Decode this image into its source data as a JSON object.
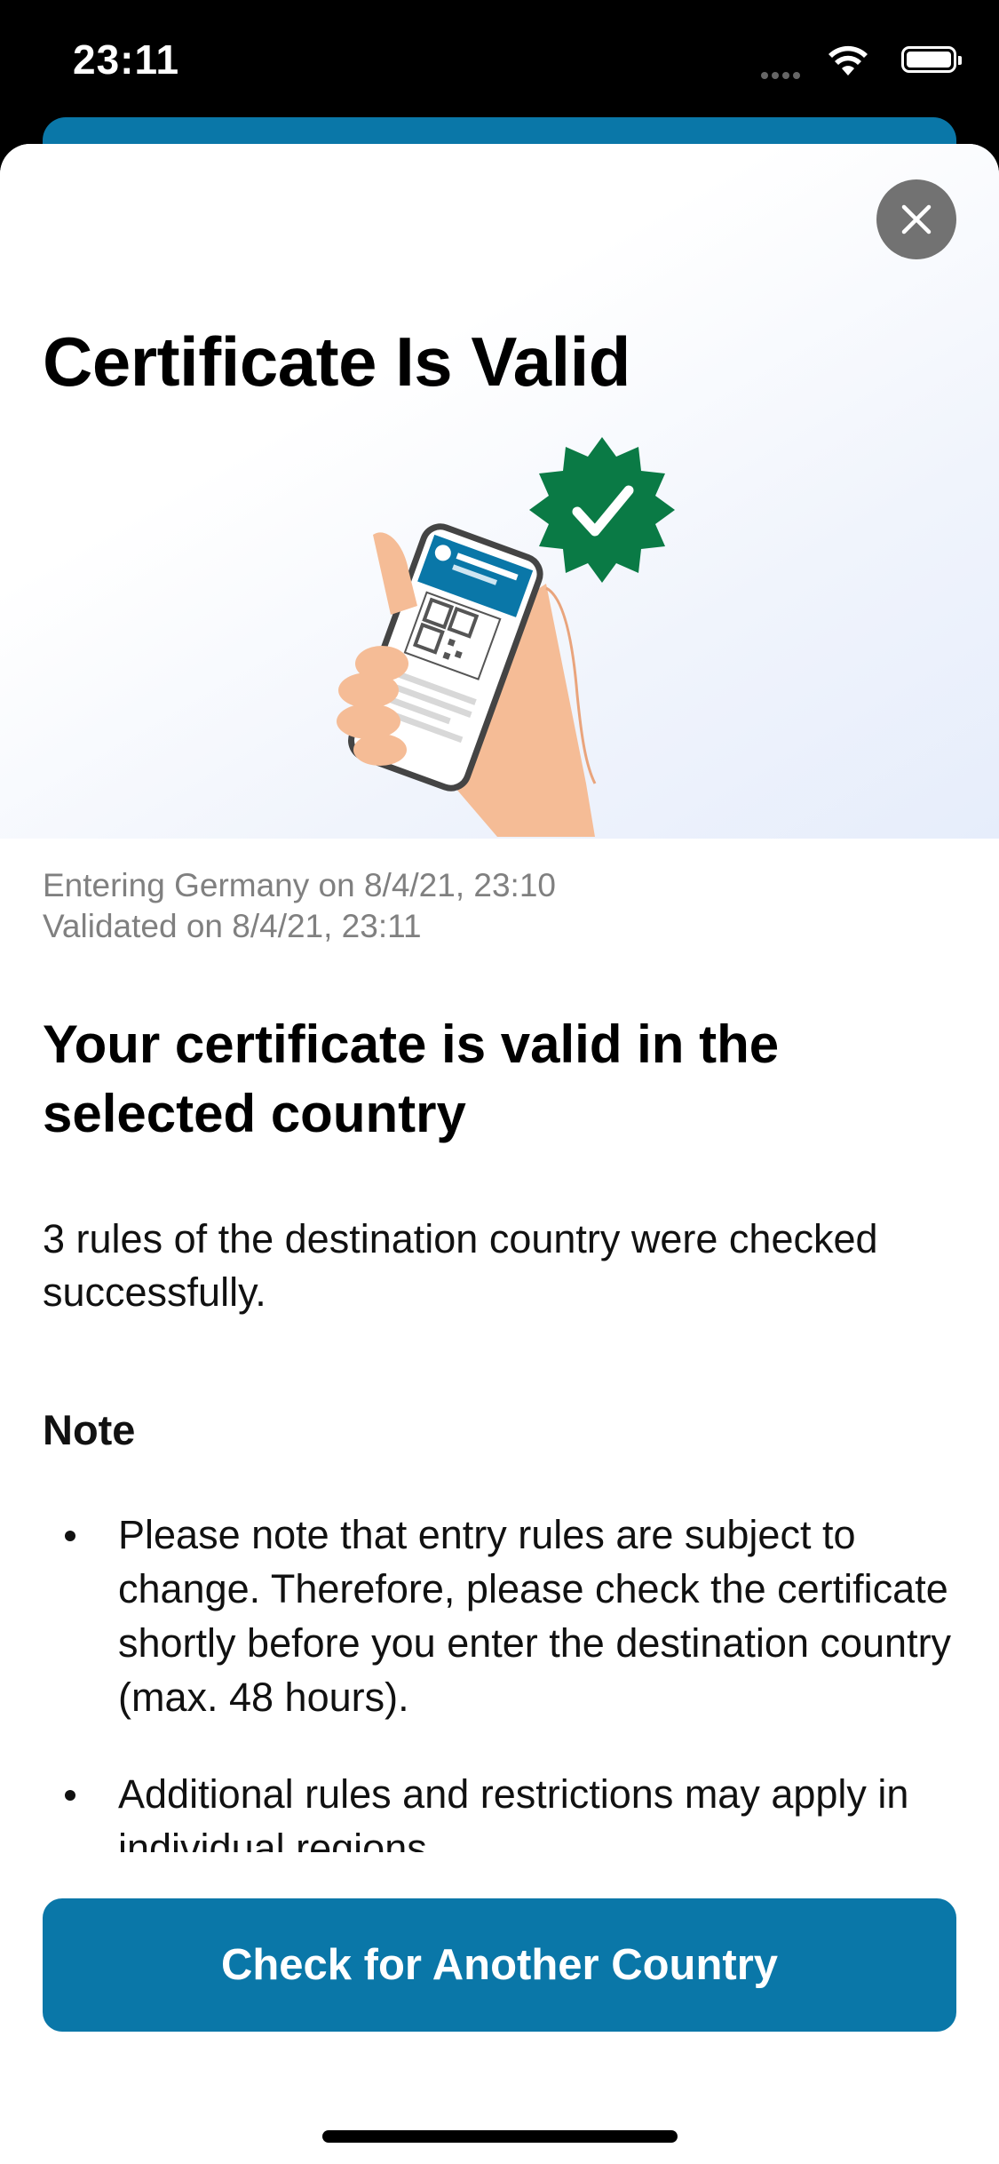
{
  "status_bar": {
    "time": "23:11"
  },
  "sheet": {
    "title": "Certificate Is Valid",
    "entry_line": "Entering Germany on 8/4/21, 23:10",
    "validated_line": "Validated on 8/4/21, 23:11",
    "headline": "Your certificate is valid in the selected country",
    "body": "3 rules of the destination country were checked successfully.",
    "note_title": "Note",
    "notes": [
      "Please note that entry rules are subject to change. Therefore, please check the certificate shortly before you enter the destination country (max. 48 hours).",
      "Additional rules and restrictions may apply in individual regions."
    ],
    "primary_button_label": "Check for Another Country"
  },
  "icons": {
    "close": "close-icon",
    "badge": "check-badge-icon",
    "wifi": "wifi-icon",
    "battery": "battery-icon",
    "signal": "signal-icon"
  },
  "colors": {
    "accent": "#0a77a8",
    "badge_green": "#0a7a45",
    "close_bg": "#727272"
  }
}
